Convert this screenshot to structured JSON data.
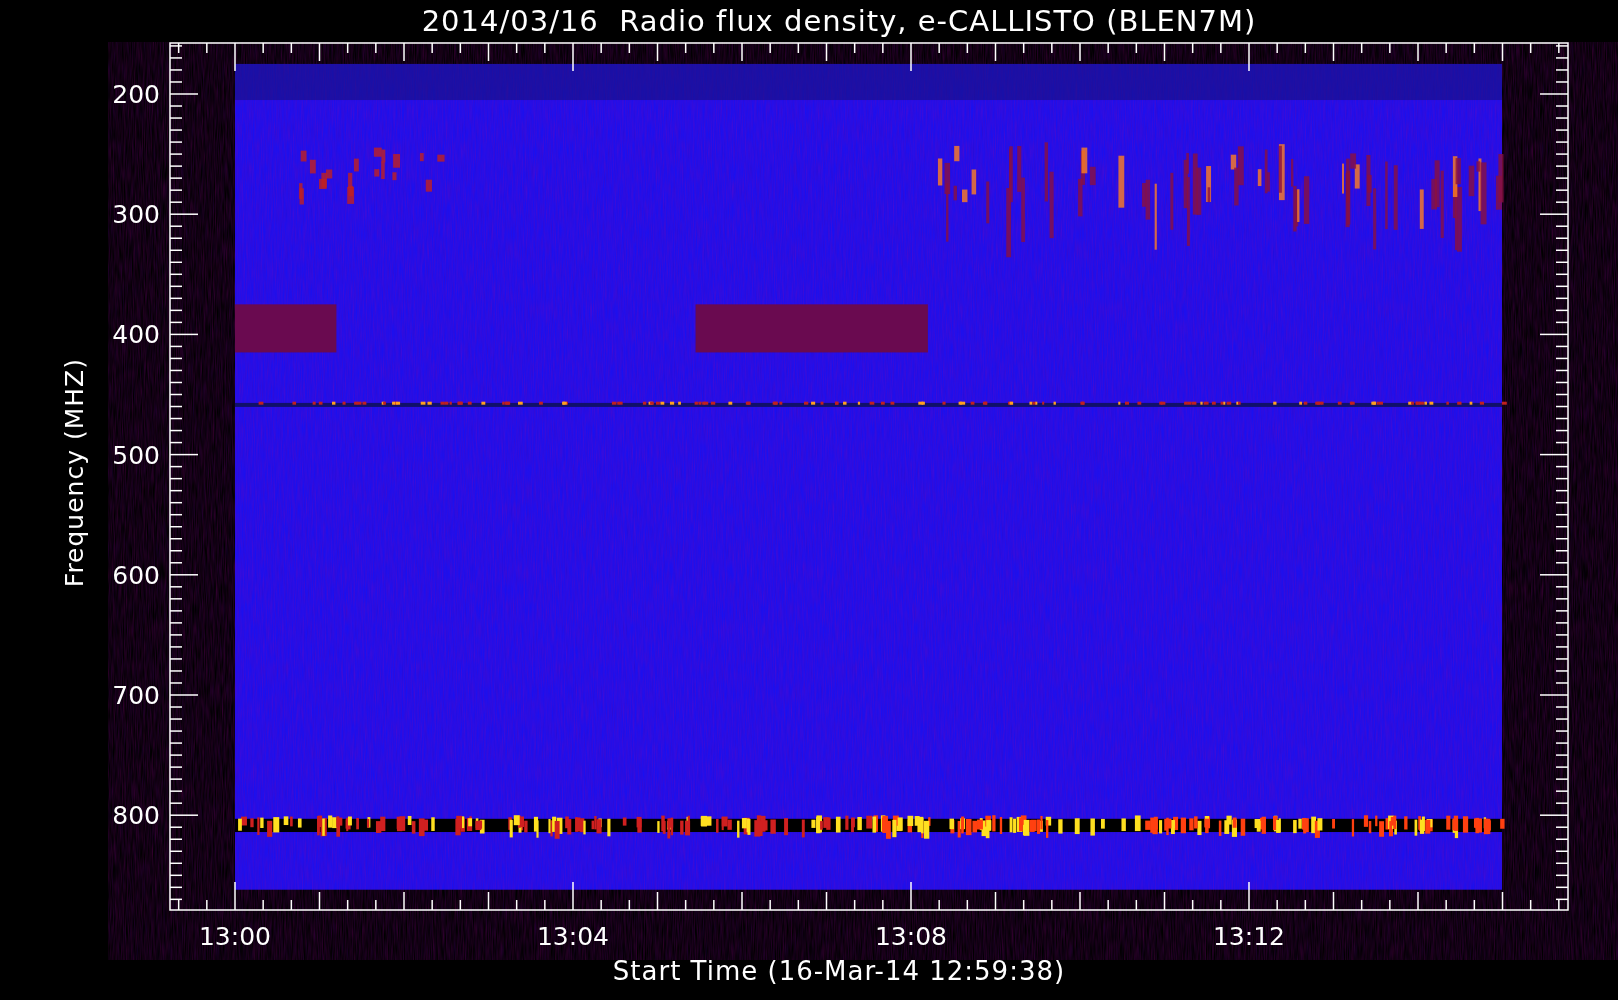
{
  "title": "2014/03/16  Radio flux density, e-CALLISTO (BLEN7M)",
  "y_axis": {
    "label": "Frequency (MHZ)",
    "ticks": [
      "200",
      "300",
      "400",
      "500",
      "600",
      "700",
      "800"
    ]
  },
  "x_axis": {
    "label": "Start Time (16-Mar-14 12:59:38)",
    "ticks": [
      "13:00",
      "13:04",
      "13:08",
      "13:12"
    ]
  }
}
